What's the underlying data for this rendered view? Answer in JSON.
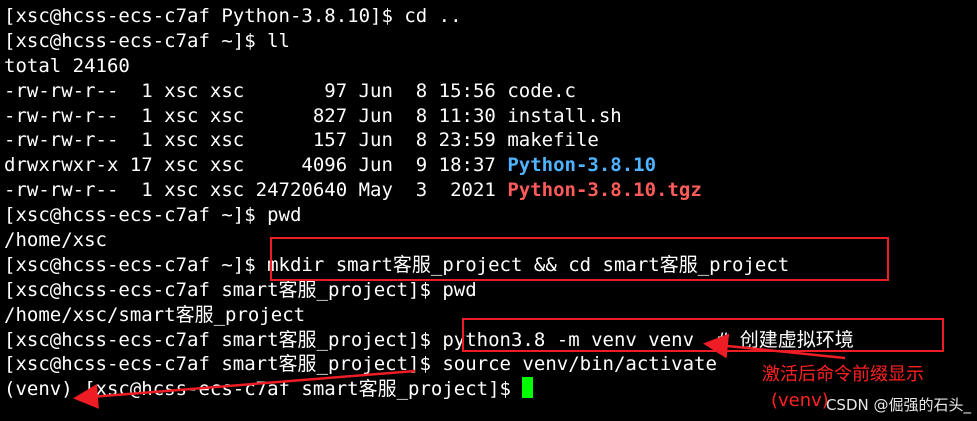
{
  "terminal": {
    "l0": "[xsc@hcss-ecs-c7af Python-3.8.10]$ cd ..",
    "l1": "[xsc@hcss-ecs-c7af ~]$ ll",
    "l2": "total 24160",
    "l3": "-rw-rw-r--  1 xsc xsc       97 Jun  8 15:56 code.c",
    "l4": "-rw-rw-r--  1 xsc xsc      827 Jun  8 11:30 install.sh",
    "l5": "-rw-rw-r--  1 xsc xsc      157 Jun  8 23:59 makefile",
    "l6_prefix": "drwxrwxr-x 17 xsc xsc     4096 Jun  9 18:37 ",
    "l6_name": "Python-3.8.10",
    "l7_prefix": "-rw-rw-r--  1 xsc xsc 24720640 May  3  2021 ",
    "l7_name": "Python-3.8.10.tgz",
    "l8": "[xsc@hcss-ecs-c7af ~]$ pwd",
    "l9": "/home/xsc",
    "l10": "[xsc@hcss-ecs-c7af ~]$ mkdir smart客服_project && cd smart客服_project",
    "l11": "[xsc@hcss-ecs-c7af smart客服_project]$ pwd",
    "l12": "/home/xsc/smart客服_project",
    "l13": "[xsc@hcss-ecs-c7af smart客服_project]$ python3.8 -m venv venv  # 创建虚拟环境",
    "l14": "[xsc@hcss-ecs-c7af smart客服_project]$ source venv/bin/activate",
    "l15": "(venv) [xsc@hcss-ecs-c7af smart客服_project]$ "
  },
  "annotation": {
    "text1": "激活后命令前缀显示",
    "text2": "(venv)"
  },
  "watermark": "CSDN @倔强的石头_",
  "colors": {
    "background": "#000000",
    "text": "#ffffff",
    "directory": "#4fb3ff",
    "archive": "#ff5b5b",
    "cursor": "#00ff00",
    "annotation_red": "#ee1c25"
  }
}
